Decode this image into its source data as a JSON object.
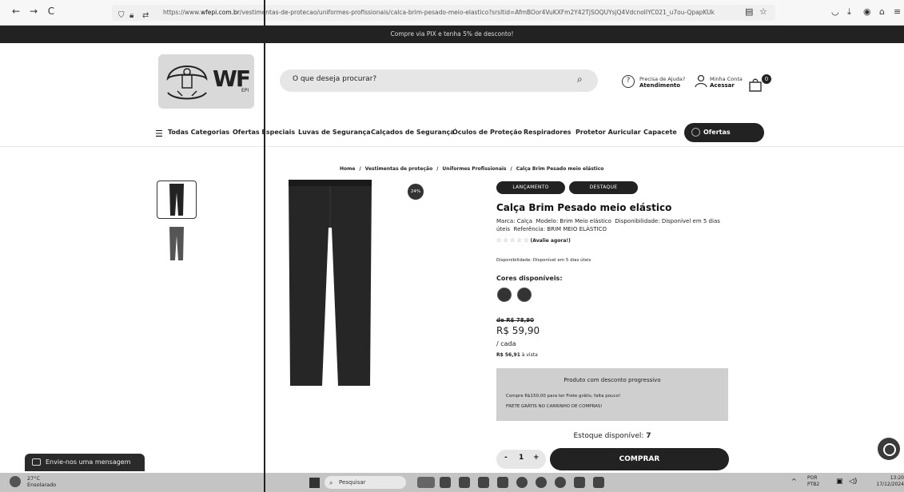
{
  "browser": {
    "back": "←",
    "forward": "→",
    "reload": "C",
    "url_prefix": "https://www.",
    "url_host": "wfepi.com.br",
    "url_path": "/vestimentas-de-protecao/uniformes-profissionais/calca-brim-pesado-meio-elastico?srsltid=AfmBOor4VuKXFm2Y42TjSOQUYsjQ4VdcnoIIYC021_u7ou-QpapKUk"
  },
  "promo_bar": "Compre via PIX e tenha 5% de desconto!",
  "header": {
    "logo_text": "WF",
    "logo_sub": "EPI",
    "search_placeholder": "O que deseja procurar?",
    "help_line1": "Precisa de Ajuda?",
    "help_line2": "Atendimento",
    "account_line1": "Minha Conta",
    "account_line2": "Acessar",
    "cart_count": "0"
  },
  "categories": [
    "Todas Categorias",
    "Ofertas Especiais",
    "Luvas de Segurança",
    "Calçados de Segurança",
    "Óculos de Proteção",
    "Respiradores",
    "Protetor Auricular",
    "Capacete"
  ],
  "ofertas_pill": "Ofertas Especiais",
  "breadcrumb": [
    "Home",
    "Vestimentas de proteção",
    "Uniformes Profissionais",
    "Calça Brim Pesado meio elástico"
  ],
  "discount_badge": "24%",
  "tags": [
    "LANÇAMENTO",
    "DESTAQUE"
  ],
  "product": {
    "title": "Calça Brim Pesado meio elástico",
    "marca_label": "Marca:",
    "marca": "Calça",
    "modelo_label": "Modelo:",
    "modelo": "Brim Meio elástico",
    "disp_label": "Disponibilidade:",
    "disp": "Disponível em 5 dias úteis",
    "ref_label": "Referência:",
    "ref": "BRIM MEIO ELÁSTICO",
    "stars": "☆ ☆ ☆ ☆ ☆",
    "rating_cta": "(Avalie agora!)",
    "disp_small": "Disponibilidade: Disponível em 5 dias úteis",
    "colors_label": "Cores disponíveis:",
    "old_price": "de R$ 78,90",
    "price": "R$ 59,90",
    "per_unit": "/ cada",
    "cash_value": "R$ 56,91",
    "cash_suffix": "à vista"
  },
  "promo_box": {
    "title": "Produto com desconto progressivo",
    "line1": "Compre R$150,00 para ter Frete grátis, falta pouco!",
    "line2": "FRETE GRÁTIS NO CARRINHO DE COMPRAS!"
  },
  "stock_label": "Estoque disponível:",
  "stock_value": "7",
  "qty": {
    "minus": "-",
    "value": "1",
    "plus": "+"
  },
  "buy_label": "COMPRAR",
  "chat_label": "Envie-nos uma mensagem",
  "taskbar": {
    "temp": "27°C",
    "weather": "Ensolarado",
    "search": "Pesquisar",
    "lang1": "POR",
    "lang2": "PTB2",
    "time": "13:20",
    "date": "17/12/2024"
  },
  "colors": {
    "dark": "#222222",
    "gray_box": "#cfcfcf"
  }
}
